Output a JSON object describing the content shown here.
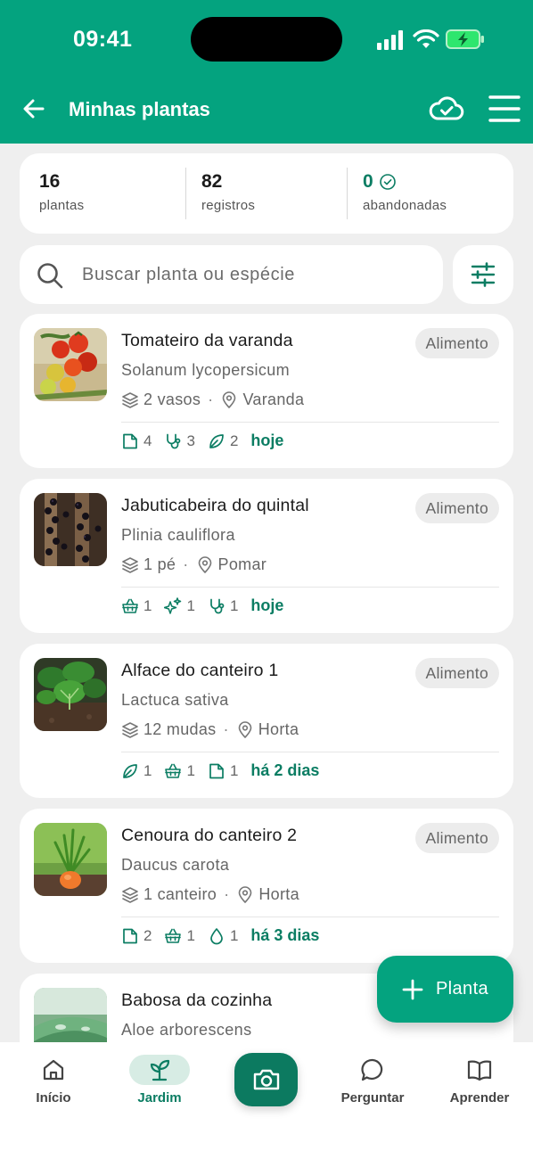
{
  "status_bar": {
    "time": "09:41"
  },
  "header": {
    "title": "Minhas plantas"
  },
  "stats": [
    {
      "value": "16",
      "label": "plantas"
    },
    {
      "value": "82",
      "label": "registros"
    },
    {
      "value": "0",
      "label": "abandonadas"
    }
  ],
  "search": {
    "placeholder": "Buscar planta ou espécie",
    "value": ""
  },
  "plants": [
    {
      "name": "Tomateiro da varanda",
      "species": "Solanum lycopersicum",
      "badge": "Alimento",
      "count": "2 vasos",
      "location": "Varanda",
      "activities": [
        {
          "icon": "note-icon",
          "count": "4"
        },
        {
          "icon": "stethoscope-icon",
          "count": "3"
        },
        {
          "icon": "leaf-icon",
          "count": "2"
        }
      ],
      "when": "hoje"
    },
    {
      "name": "Jabuticabeira do quintal",
      "species": "Plinia cauliflora",
      "badge": "Alimento",
      "count": "1 pé",
      "location": "Pomar",
      "activities": [
        {
          "icon": "basket-icon",
          "count": "1"
        },
        {
          "icon": "sparkle-icon",
          "count": "1"
        },
        {
          "icon": "stethoscope-icon",
          "count": "1"
        }
      ],
      "when": "hoje"
    },
    {
      "name": "Alface do canteiro 1",
      "species": "Lactuca sativa",
      "badge": "Alimento",
      "count": "12 mudas",
      "location": "Horta",
      "activities": [
        {
          "icon": "leaf-icon",
          "count": "1"
        },
        {
          "icon": "basket-icon",
          "count": "1"
        },
        {
          "icon": "note-icon",
          "count": "1"
        }
      ],
      "when": "há 2 dias"
    },
    {
      "name": "Cenoura do canteiro 2",
      "species": "Daucus carota",
      "badge": "Alimento",
      "count": "1 canteiro",
      "location": "Horta",
      "activities": [
        {
          "icon": "note-icon",
          "count": "2"
        },
        {
          "icon": "basket-icon",
          "count": "1"
        },
        {
          "icon": "drop-icon",
          "count": "1"
        }
      ],
      "when": "há 3 dias"
    },
    {
      "name": "Babosa da cozinha",
      "species": "Aloe arborescens"
    }
  ],
  "fab": {
    "label": "Planta"
  },
  "nav": [
    {
      "label": "Início",
      "icon": "home-icon"
    },
    {
      "label": "Jardim",
      "icon": "sprout-icon"
    },
    {
      "label": "",
      "icon": "camera-icon"
    },
    {
      "label": "Perguntar",
      "icon": "chat-icon"
    },
    {
      "label": "Aprender",
      "icon": "book-icon"
    }
  ],
  "colors": {
    "brand": "#04a37f",
    "brand_dark": "#0c7a60",
    "accent_text": "#0b7d63",
    "background": "#efefef"
  }
}
